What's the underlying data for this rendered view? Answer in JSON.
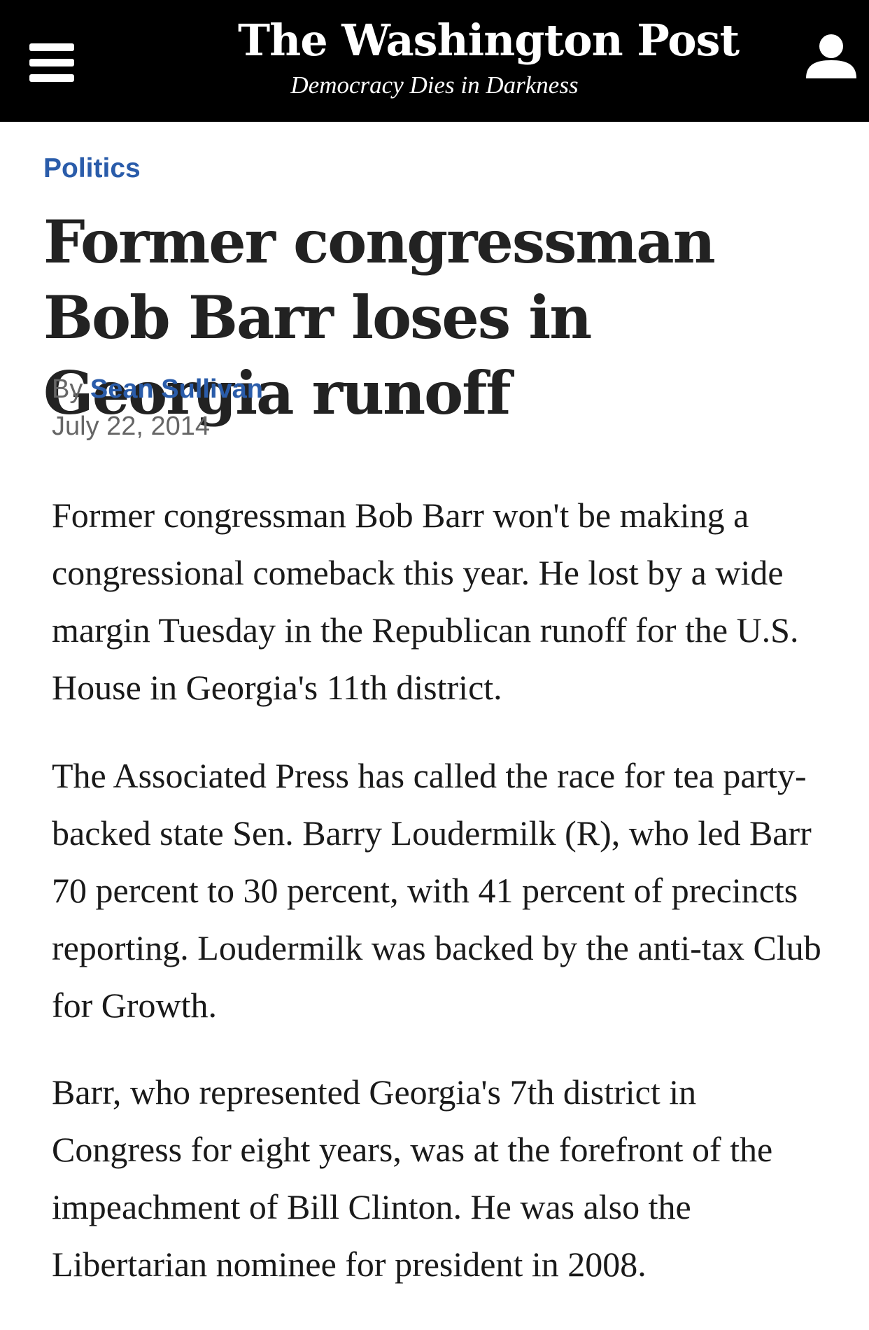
{
  "header": {
    "logo_text": "The Washington Post",
    "tagline": "Democracy Dies in Darkness",
    "menu_icon": "hamburger-menu-icon",
    "account_icon": "user-account-icon",
    "background_color": "#000000",
    "text_color": "#ffffff"
  },
  "article": {
    "section": "Politics",
    "headline": "Former congressman Bob Barr loses in Georgia runoff",
    "byline_prefix": "By",
    "author": "Sean Sullivan",
    "date": "July 22, 2014",
    "paragraphs": [
      "Former congressman Bob Barr won't be making a congressional comeback this year. He lost by a wide margin Tuesday in the Republican runoff for the U.S. House in Georgia's 11th district.",
      "The Associated Press has called the race for tea party-backed state Sen. Barry Loudermilk (R), who led Barr 70 percent to 30 percent, with 41 percent of precincts reporting. Loudermilk was backed by the anti-tax Club for Growth.",
      "Barr, who represented Georgia's 7th district in Congress for eight years, was at the forefront of the impeachment of Bill Clinton. He was also the Libertarian nominee for president in 2008."
    ]
  },
  "colors": {
    "link_blue": "#2a5caa",
    "meta_gray": "#666666",
    "headline_text": "#222222",
    "body_text": "#1a1a1a"
  }
}
